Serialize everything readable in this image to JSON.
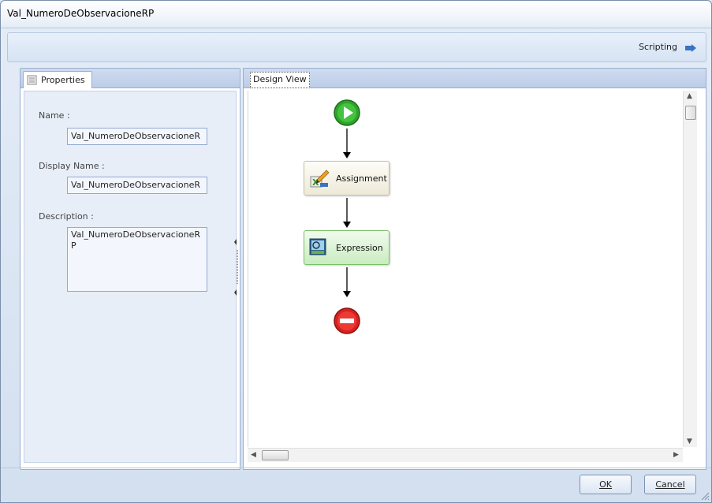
{
  "window": {
    "title": "Val_NumeroDeObservacioneRP"
  },
  "toolbar": {
    "scripting_label": "Scripting",
    "scripting_icon": "scripting-arrow-icon"
  },
  "properties_panel": {
    "tab_label": "Properties",
    "tab_icon": "scroll-properties-icon",
    "name_label": "Name :",
    "name_value": "Val_NumeroDeObservacioneR",
    "display_name_label": "Display Name :",
    "display_name_value": "Val_NumeroDeObservacioneR",
    "description_label": "Description :",
    "description_value": "Val_NumeroDeObservacioneRP"
  },
  "design_view": {
    "tab_label": "Design View",
    "start_icon": "start-play-icon",
    "end_icon": "end-stop-icon",
    "activities": [
      {
        "label": "Assignment",
        "icon": "assignment-icon",
        "color": "#ede9d8"
      },
      {
        "label": "Expression",
        "icon": "expression-icon",
        "color": "#c9ecc0"
      }
    ]
  },
  "buttons": {
    "ok_label": "OK",
    "cancel_label": "Cancel"
  },
  "colors": {
    "start": "#2fa32b",
    "end": "#d8221f"
  }
}
